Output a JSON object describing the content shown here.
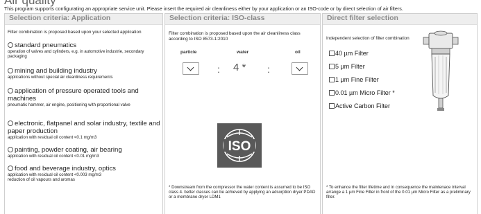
{
  "page": {
    "title": "Air quality",
    "intro": "This program supports configurating an appropriate service unit. Please insert the required air cleanliness either by your application or an ISO-code or by direct selection of air filters."
  },
  "application": {
    "heading": "Selection criteria: Application",
    "description": "Filter combination is proposed based upon your selected application",
    "options": [
      {
        "title": "standard pneumatics",
        "sub": "operation of valves and cylinders, e.g. in automotive industrie, secondary packaging"
      },
      {
        "title": "mining and building industry",
        "sub": "applications without special air cleanliness requirements"
      },
      {
        "title": "application of pressure operated tools and machines",
        "sub": "pneumatic hammer, air engine, positioning with proportional valve"
      },
      {
        "title": "electronic, flatpanel and solar industry, textile and paper production",
        "sub": "application with residual oil content <0.1 mg/m3"
      },
      {
        "title": "painting, powder coating, air bearing",
        "sub": "application with residual oil content <0.01 mg/m3"
      },
      {
        "title": "food and beverage industry, optics",
        "sub": "application with residual oil content <0.003 mg/m3\nreduction of oil vapours and aromas"
      }
    ]
  },
  "iso": {
    "heading": "Selection criteria: ISO-class",
    "description": "Filter combination is proposed based upon the air cleanliness class according to ISO 8573-1:2010",
    "labels": {
      "particle": "particle",
      "water": "water",
      "oil": "oil"
    },
    "water_value": "4 *",
    "colon": ":",
    "logo_text": "ISO",
    "note": "* Downstream from the compressor the water content is assumed to be ISO class 4. better classes can be achieved by applying an adsorption dryer PDAD or a membrane dryer LDM1"
  },
  "filter": {
    "heading": "Direct filter selection",
    "description": "Independent selection of filter combination",
    "options": [
      "40 µm Filter",
      "5 µm Filter",
      "1 µm Fine Filter",
      "0.01 µm Micro Filter *",
      "Active Carbon Filter"
    ],
    "note": "* To enhance the filter lifetime and in consequence the maintenace interval arrange a 1 µm Fine Filter in front of the 0.01 µm Micro Filter as a preliminary filter."
  }
}
